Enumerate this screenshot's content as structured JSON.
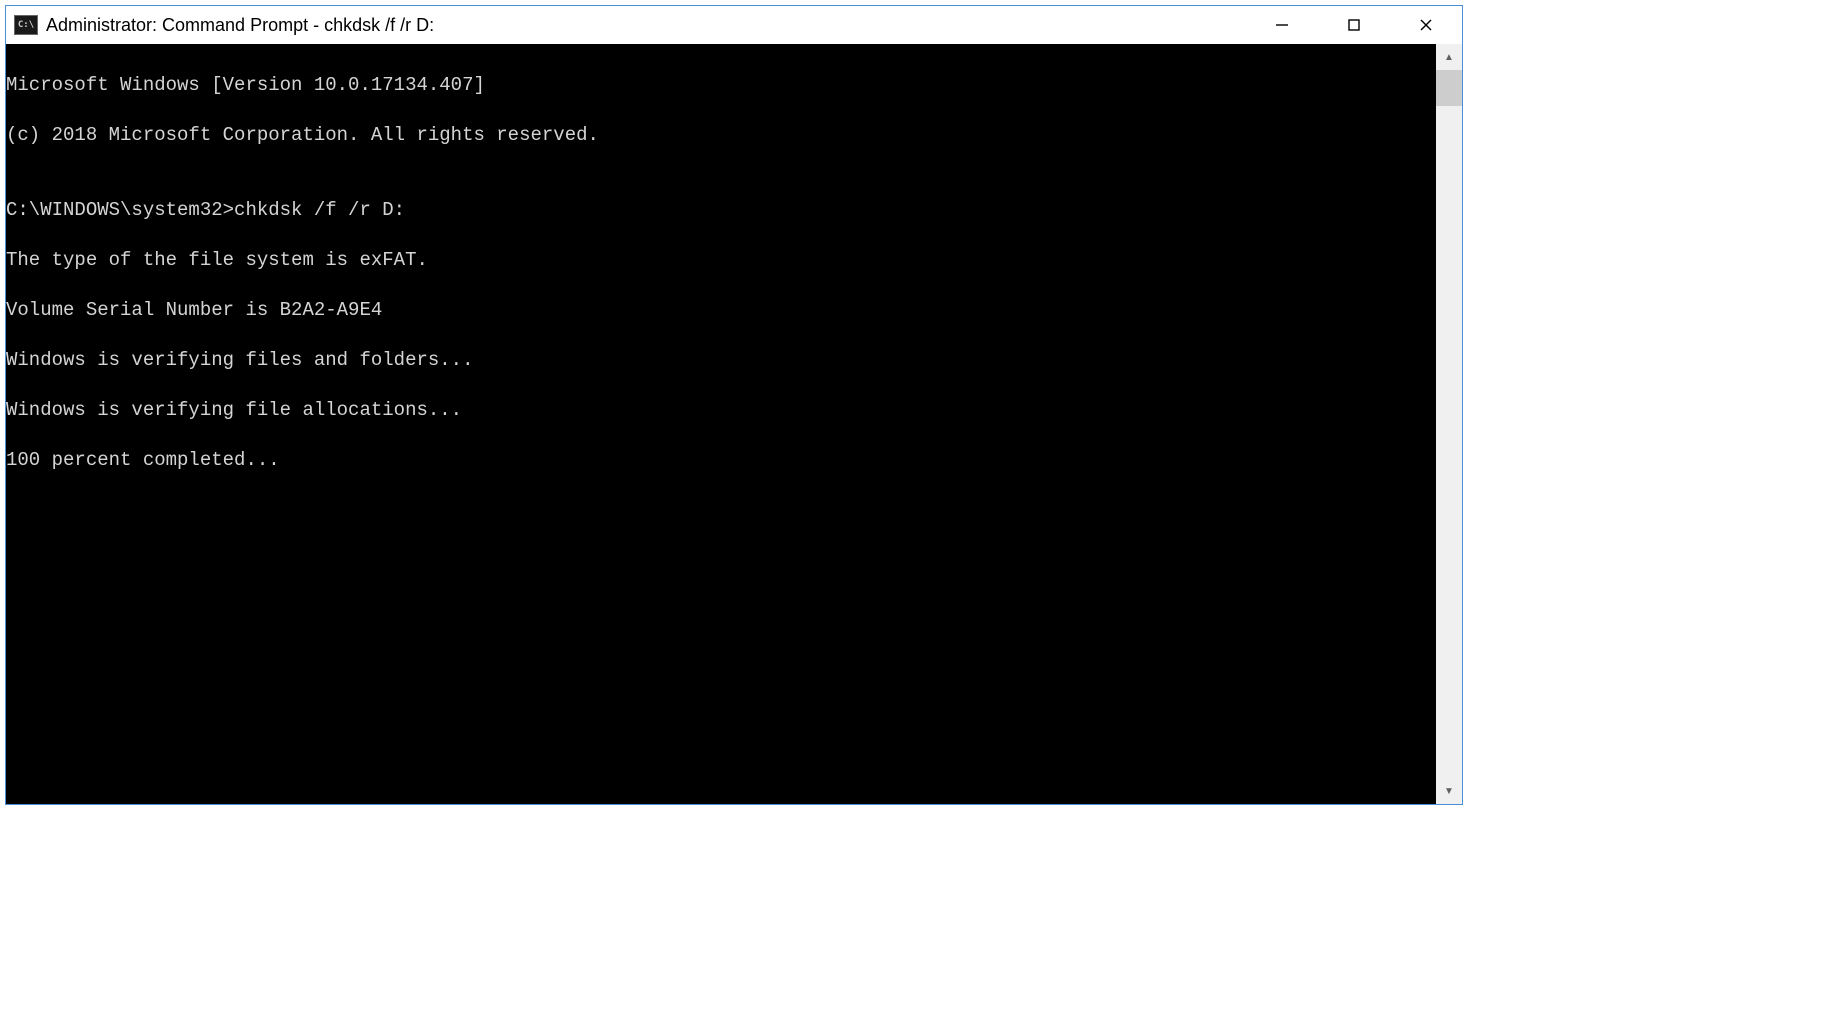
{
  "window": {
    "title": "Administrator: Command Prompt - chkdsk  /f /r D:",
    "icon_label": "C:\\"
  },
  "titlebar_buttons": {
    "minimize_tooltip": "Minimize",
    "maximize_tooltip": "Maximize",
    "close_tooltip": "Close"
  },
  "console": {
    "lines": [
      "Microsoft Windows [Version 10.0.17134.407]",
      "(c) 2018 Microsoft Corporation. All rights reserved.",
      "",
      "C:\\WINDOWS\\system32>chkdsk /f /r D:",
      "The type of the file system is exFAT.",
      "Volume Serial Number is B2A2-A9E4",
      "Windows is verifying files and folders...",
      "Windows is verifying file allocations...",
      "100 percent completed..."
    ]
  },
  "scrollbar": {
    "up": "▲",
    "down": "▼"
  }
}
